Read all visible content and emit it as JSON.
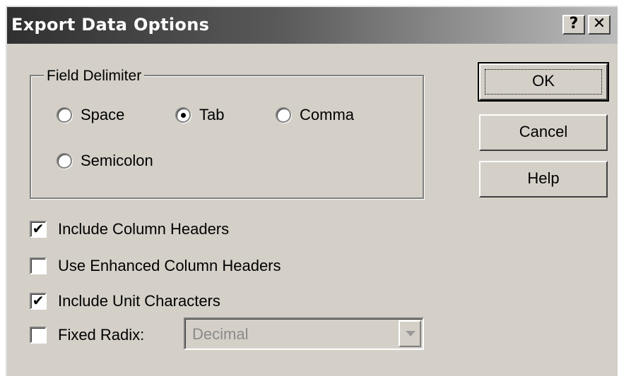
{
  "window": {
    "title": "Export Data Options",
    "help_button": "?",
    "close_button": "✕"
  },
  "field_delimiter": {
    "label": "Field Delimiter",
    "options": [
      "Space",
      "Tab",
      "Comma",
      "Semicolon"
    ],
    "selected": "Tab"
  },
  "options": {
    "include_column_headers": {
      "label": "Include Column Headers",
      "checked": true
    },
    "use_enhanced_column_headers": {
      "label": "Use Enhanced Column Headers",
      "checked": false
    },
    "include_unit_characters": {
      "label": "Include Unit Characters",
      "checked": true
    },
    "fixed_radix": {
      "label": "Fixed Radix:",
      "checked": false
    }
  },
  "radix_select": {
    "value": "Decimal"
  },
  "buttons": {
    "ok": "OK",
    "cancel": "Cancel",
    "help": "Help"
  },
  "check_mark": "✔",
  "radio_dot": "•"
}
